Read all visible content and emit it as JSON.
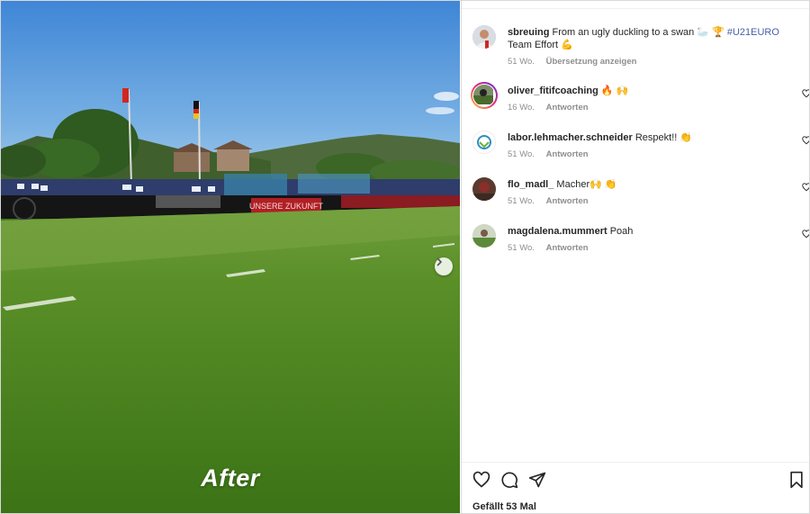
{
  "photo": {
    "overlay_text": "After",
    "banner_text": "UNSERE ZUKUNFT",
    "next_icon": "chevron-right-icon"
  },
  "caption": {
    "username": "sbreuing",
    "text": "From an ugly duckling to a swan 🦢 🏆",
    "hashtag": "#U21EURO",
    "text_after": "Team Effort 💪",
    "time": "51 Wo.",
    "translate": "Übersetzung anzeigen"
  },
  "comments": [
    {
      "username": "oliver_fitifcoaching",
      "text": "🔥 🙌",
      "time": "16 Wo.",
      "reply": "Antworten"
    },
    {
      "username": "labor.lehmacher.schneider",
      "text": "Respekt!! 👏",
      "time": "51 Wo.",
      "reply": "Antworten"
    },
    {
      "username": "flo_madl_",
      "text": "Macher🙌 👏",
      "time": "51 Wo.",
      "reply": "Antworten"
    },
    {
      "username": "magdalena.mummert",
      "text": "Poah",
      "time": "51 Wo.",
      "reply": "Antworten"
    }
  ],
  "actions": {
    "like_icon": "heart-icon",
    "comment_icon": "comment-icon",
    "share_icon": "send-icon",
    "save_icon": "bookmark-icon"
  },
  "likes": "Gefällt 53 Mal",
  "colors": {
    "hashtag": "#4b5fa6",
    "secondary_text": "#8e8e8e",
    "primary_text": "#262626"
  }
}
